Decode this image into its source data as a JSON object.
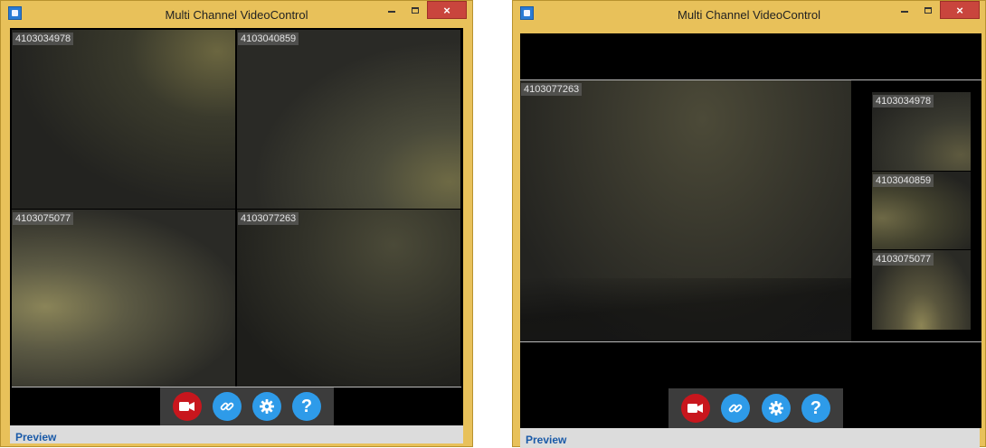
{
  "windows": [
    {
      "title": "Multi Channel VideoControl",
      "status": "Preview",
      "cameras": [
        "4103034978",
        "4103040859",
        "4103075077",
        "4103077263"
      ]
    },
    {
      "title": "Multi Channel VideoControl",
      "status": "Preview",
      "main_camera": "4103077263",
      "side_cameras": [
        "4103034978",
        "4103040859",
        "4103075077"
      ]
    }
  ],
  "window_controls": {
    "minimize": "–",
    "maximize": "□",
    "close": "×"
  },
  "toolbar_icons": [
    "video-camera-icon",
    "link-icon",
    "gear-icon",
    "question-mark-icon"
  ],
  "colors": {
    "title_bar": "#e8c15a",
    "record": "#c8161d",
    "toolbar_button": "#2e9be9",
    "status_text": "#1a5aa8"
  }
}
